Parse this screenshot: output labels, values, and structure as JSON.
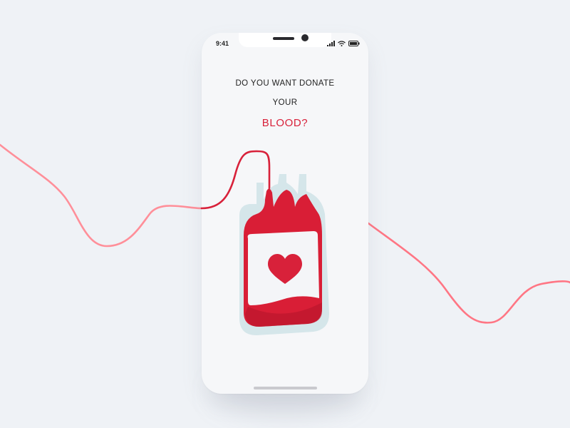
{
  "status": {
    "time": "9:41",
    "signal_icon": "signal-icon",
    "wifi_icon": "wifi-icon",
    "battery_icon": "battery-icon"
  },
  "headline": {
    "line1": "DO YOU WANT DONATE",
    "line2": "YOUR",
    "line3": "BLOOD?"
  },
  "colors": {
    "background": "#eff2f6",
    "accent": "#d8213a",
    "line": "#ff8f99"
  },
  "illustration": {
    "name": "blood-bag",
    "icon": "heart-icon"
  }
}
